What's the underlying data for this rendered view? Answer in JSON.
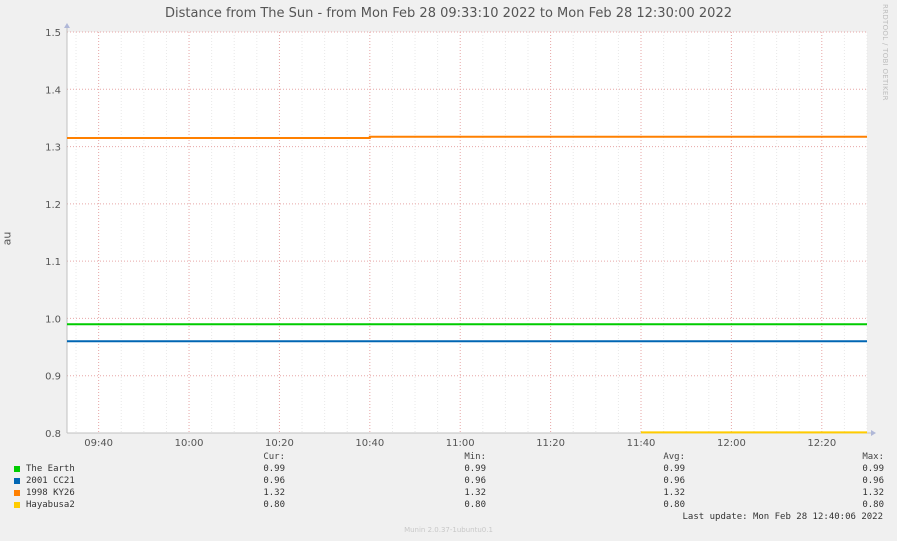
{
  "chart_data": {
    "type": "line",
    "title": "Distance from The Sun - from Mon Feb 28 09:33:10 2022 to Mon Feb 28 12:30:00 2022",
    "xlabel": "",
    "ylabel": "au",
    "x_range": [
      "09:33",
      "12:30"
    ],
    "ylim": [
      0.8,
      1.5
    ],
    "x_ticks": [
      "09:40",
      "10:00",
      "10:20",
      "10:40",
      "11:00",
      "11:20",
      "11:40",
      "12:00",
      "12:20"
    ],
    "y_ticks": [
      "1.5",
      "1.4",
      "1.3",
      "1.2",
      "1.1",
      "1.0",
      "0.9",
      "0.8"
    ],
    "grid": true,
    "series": [
      {
        "name": "The Earth",
        "color": "#00cc00",
        "points": [
          [
            "09:33",
            0.99
          ],
          [
            "12:30",
            0.99
          ]
        ]
      },
      {
        "name": "2001 CC21",
        "color": "#0066b3",
        "points": [
          [
            "09:33",
            0.96
          ],
          [
            "12:30",
            0.96
          ]
        ]
      },
      {
        "name": "1998 KY26",
        "color": "#ff8000",
        "points": [
          [
            "09:33",
            1.315
          ],
          [
            "10:40",
            1.315
          ],
          [
            "10:40",
            1.317
          ],
          [
            "12:30",
            1.317
          ]
        ]
      },
      {
        "name": "Hayabusa2",
        "color": "#ffcc00",
        "points": [
          [
            "11:40",
            0.801
          ],
          [
            "12:30",
            0.801
          ]
        ]
      }
    ],
    "legend": {
      "headers": [
        "Cur:",
        "Min:",
        "Avg:",
        "Max:"
      ],
      "rows": [
        {
          "name": "The Earth",
          "color": "#00cc00",
          "cur": "0.99",
          "min": "0.99",
          "avg": "0.99",
          "max": "0.99"
        },
        {
          "name": "2001 CC21",
          "color": "#0066b3",
          "cur": "0.96",
          "min": "0.96",
          "avg": "0.96",
          "max": "0.96"
        },
        {
          "name": "1998 KY26",
          "color": "#ff8000",
          "cur": "1.32",
          "min": "1.32",
          "avg": "1.32",
          "max": "1.32"
        },
        {
          "name": "Hayabusa2",
          "color": "#ffcc00",
          "cur": "0.80",
          "min": "0.80",
          "avg": "0.80",
          "max": "0.80"
        }
      ]
    }
  },
  "last_update": "Last update: Mon Feb 28 12:40:06 2022",
  "watermark": "RRDTOOL / TOBI OETIKER",
  "footer": "Munin 2.0.37-1ubuntu0.1"
}
